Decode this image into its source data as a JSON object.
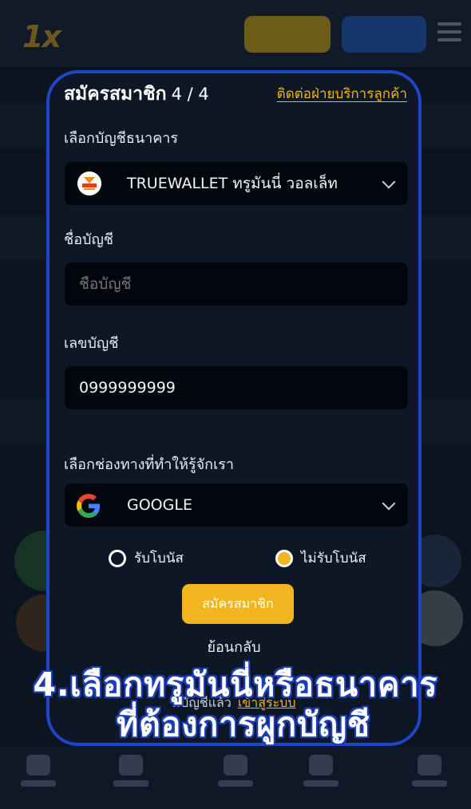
{
  "modal": {
    "title": "สมัครสมาชิก",
    "step": "4 / 4",
    "contact_link": "ติดต่อฝ่ายบริการลูกค้า",
    "bank_label": "เลือกบัญชีธนาคาร",
    "bank_selected": "TRUEWALLET ทรูมันนี่ วอลเล็ท",
    "account_name_label": "ชื่อบัญชี",
    "account_name_placeholder": "ชื่อบัญชี",
    "account_number_label": "เลขบัญชี",
    "account_number_value": "0999999999",
    "channel_label": "เลือกช่องทางที่ทำให้รู้จักเรา",
    "channel_selected": "GOOGLE",
    "bonus_options": [
      {
        "label": "รับโบนัส",
        "selected": false
      },
      {
        "label": "ไม่รับโบนัส",
        "selected": true
      }
    ],
    "submit_label": "สมัครสมาชิก",
    "back_label": "ย้อนกลับ",
    "login_prompt": "มีบัญชีแล้ว",
    "login_link": "เข้าสู่ระบบ"
  },
  "caption": {
    "line1": "4.เลือกทรูมันนี่หรือธนาคาร",
    "line2": "ที่ต้องการผูกบัญชี"
  },
  "colors": {
    "accent": "#f2b51d",
    "border": "#1f46c8",
    "background": "#0d1725",
    "field": "#03070d"
  },
  "icons": [
    "truemoney-logo-icon",
    "chevron-down-icon",
    "google-logo-icon"
  ]
}
